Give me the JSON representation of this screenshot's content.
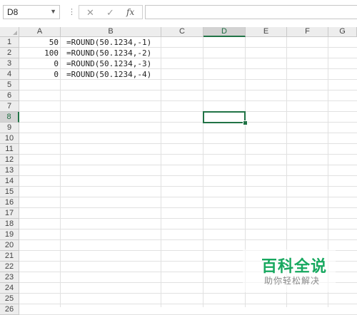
{
  "formula_bar": {
    "name_box_value": "D8",
    "name_box_dropdown_icon": "chevron-down-icon",
    "separator_icon": "more-vert-icon",
    "cancel_icon": "close-icon",
    "enter_icon": "check-icon",
    "fx_label": "fx",
    "formula_value": ""
  },
  "sheet": {
    "columns": [
      "A",
      "B",
      "C",
      "D",
      "E",
      "F",
      "G"
    ],
    "selected_column": "D",
    "rows": [
      "1",
      "2",
      "3",
      "4",
      "5",
      "6",
      "7",
      "8",
      "9",
      "10",
      "11",
      "12",
      "13",
      "14",
      "15",
      "16",
      "17",
      "18",
      "19",
      "20",
      "21",
      "22",
      "23",
      "24",
      "25",
      "26"
    ],
    "selected_row": "8",
    "cells": {
      "A1": "50",
      "A2": "100",
      "A3": "0",
      "A4": "0",
      "B1": "=ROUND(50.1234,-1)",
      "B2": "=ROUND(50.1234,-2)",
      "B3": "=ROUND(50.1234,-3)",
      "B4": "=ROUND(50.1234,-4)"
    },
    "active_cell": "D8",
    "accent_color": "#217346"
  },
  "watermark": {
    "title": "百科全说",
    "subtitle": "助你轻松解决",
    "color": "#17a85f"
  }
}
